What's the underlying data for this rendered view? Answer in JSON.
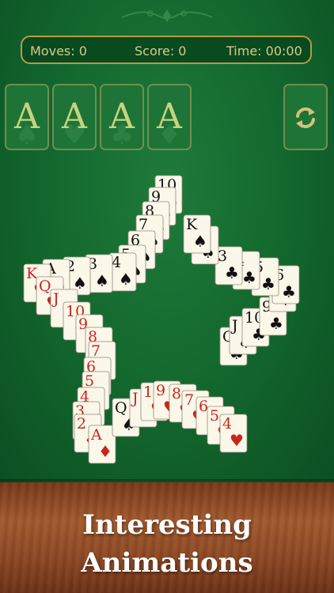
{
  "status": {
    "moves_label": "Moves:",
    "moves_value": "0",
    "score_label": "Score:",
    "score_value": "0",
    "time_label": "Time:",
    "time_value": "00:00"
  },
  "foundations": [
    {
      "rank": "A",
      "suit_icon": "spade-icon"
    },
    {
      "rank": "A",
      "suit_icon": "heart-icon"
    },
    {
      "rank": "A",
      "suit_icon": "club-icon"
    },
    {
      "rank": "A",
      "suit_icon": "diamond-icon"
    }
  ],
  "restart_icon": "refresh-icon",
  "caption": {
    "line1": "Interesting",
    "line2": "Animations"
  },
  "colors": {
    "felt": "#146a2f",
    "gold": "#b89a45",
    "red_suit": "#c8261d",
    "black_suit": "#111111",
    "card": "#fbf7e9"
  },
  "star_cards": [
    {
      "rank": "10",
      "suit": "♠",
      "color": "black"
    },
    {
      "rank": "9",
      "suit": "♠",
      "color": "black"
    },
    {
      "rank": "8",
      "suit": "♠",
      "color": "black"
    },
    {
      "rank": "7",
      "suit": "♠",
      "color": "black"
    },
    {
      "rank": "6",
      "suit": "♠",
      "color": "black"
    },
    {
      "rank": "5",
      "suit": "♠",
      "color": "black"
    },
    {
      "rank": "4",
      "suit": "♠",
      "color": "black"
    },
    {
      "rank": "3",
      "suit": "♠",
      "color": "black"
    },
    {
      "rank": "2",
      "suit": "♠",
      "color": "black"
    },
    {
      "rank": "A",
      "suit": "♠",
      "color": "black"
    },
    {
      "rank": "K",
      "suit": "♥",
      "color": "red"
    },
    {
      "rank": "Q",
      "suit": "♥",
      "color": "red"
    },
    {
      "rank": "J",
      "suit": "♦",
      "color": "red"
    },
    {
      "rank": "10",
      "suit": "♦",
      "color": "red"
    },
    {
      "rank": "9",
      "suit": "♦",
      "color": "red"
    },
    {
      "rank": "8",
      "suit": "♦",
      "color": "red"
    },
    {
      "rank": "7",
      "suit": "♦",
      "color": "red"
    },
    {
      "rank": "6",
      "suit": "♦",
      "color": "red"
    },
    {
      "rank": "5",
      "suit": "♦",
      "color": "red"
    },
    {
      "rank": "4",
      "suit": "♦",
      "color": "red"
    },
    {
      "rank": "3",
      "suit": "♦",
      "color": "red"
    },
    {
      "rank": "2",
      "suit": "♦",
      "color": "red"
    },
    {
      "rank": "A",
      "suit": "♦",
      "color": "red"
    },
    {
      "rank": "Q",
      "suit": "♠",
      "color": "black"
    },
    {
      "rank": "J",
      "suit": "♥",
      "color": "red"
    },
    {
      "rank": "10",
      "suit": "♥",
      "color": "red"
    },
    {
      "rank": "9",
      "suit": "♥",
      "color": "red"
    },
    {
      "rank": "8",
      "suit": "♥",
      "color": "red"
    },
    {
      "rank": "7",
      "suit": "♥",
      "color": "red"
    },
    {
      "rank": "6",
      "suit": "♥",
      "color": "red"
    },
    {
      "rank": "5",
      "suit": "♥",
      "color": "red"
    },
    {
      "rank": "4",
      "suit": "♥",
      "color": "red"
    },
    {
      "rank": "Q",
      "suit": "♣",
      "color": "black"
    },
    {
      "rank": "J",
      "suit": "♣",
      "color": "black"
    },
    {
      "rank": "10",
      "suit": "♣",
      "color": "black"
    },
    {
      "rank": "9",
      "suit": "♣",
      "color": "black"
    },
    {
      "rank": "8",
      "suit": "♣",
      "color": "black"
    },
    {
      "rank": "6",
      "suit": "♣",
      "color": "black"
    },
    {
      "rank": "5",
      "suit": "♣",
      "color": "black"
    },
    {
      "rank": "4",
      "suit": "♣",
      "color": "black"
    },
    {
      "rank": "3",
      "suit": "♣",
      "color": "black"
    },
    {
      "rank": "J",
      "suit": "♠",
      "color": "black"
    },
    {
      "rank": "K",
      "suit": "♠",
      "color": "black"
    }
  ]
}
